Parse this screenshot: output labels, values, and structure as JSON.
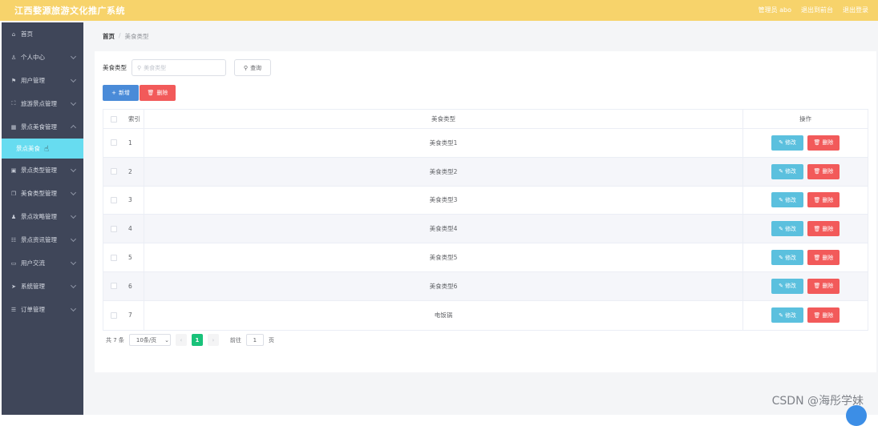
{
  "header": {
    "title": "江西婺源旅游文化推广系统",
    "links": [
      "管理员 abo",
      "退出到前台",
      "退出登录"
    ]
  },
  "sidebar": {
    "items": [
      {
        "label": "首页",
        "icon": "home-icon",
        "glyph": "⌂",
        "chevron": false
      },
      {
        "label": "个人中心",
        "icon": "user-icon",
        "glyph": "♙",
        "chevron": "down"
      },
      {
        "label": "用户管理",
        "icon": "flag-icon",
        "glyph": "⚑",
        "chevron": "down"
      },
      {
        "label": "旅游景点管理",
        "icon": "frame-icon",
        "glyph": "⛶",
        "chevron": "down"
      },
      {
        "label": "景点美食管理",
        "icon": "grid-icon",
        "glyph": "▦",
        "chevron": "up"
      }
    ],
    "active_sub": {
      "label": "景点美食"
    },
    "items_after": [
      {
        "label": "景点类型管理",
        "icon": "image-icon",
        "glyph": "▣",
        "chevron": "down"
      },
      {
        "label": "美食类型管理",
        "icon": "copy-icon",
        "glyph": "❐",
        "chevron": "down"
      },
      {
        "label": "景点攻略管理",
        "icon": "person-icon",
        "glyph": "♟",
        "chevron": "down"
      },
      {
        "label": "景点资讯管理",
        "icon": "sliders-icon",
        "glyph": "☷",
        "chevron": "down"
      },
      {
        "label": "用户交流",
        "icon": "chat-icon",
        "glyph": "▭",
        "chevron": "down"
      },
      {
        "label": "系统管理",
        "icon": "send-icon",
        "glyph": "➤",
        "chevron": "down"
      },
      {
        "label": "订单管理",
        "icon": "list-icon",
        "glyph": "☰",
        "chevron": "down"
      }
    ]
  },
  "breadcrumb": {
    "home": "首页",
    "sep": "/",
    "current": "美食类型"
  },
  "search": {
    "label": "美食类型",
    "placeholder": "美食类型",
    "button": "查询"
  },
  "actions": {
    "add": "新增",
    "delete": "删除"
  },
  "table": {
    "headers": {
      "index": "索引",
      "type": "美食类型",
      "ops": "操作"
    },
    "rows": [
      {
        "index": "1",
        "type": "美食类型1"
      },
      {
        "index": "2",
        "type": "美食类型2"
      },
      {
        "index": "3",
        "type": "美食类型3"
      },
      {
        "index": "4",
        "type": "美食类型4"
      },
      {
        "index": "5",
        "type": "美食类型5"
      },
      {
        "index": "6",
        "type": "美食类型6"
      },
      {
        "index": "7",
        "type": "电饭锅"
      }
    ],
    "edit_label": "修改",
    "delete_label": "删除"
  },
  "pagination": {
    "total": "共 7 条",
    "page_size": "10条/页",
    "current_page": "1",
    "goto_prefix": "前往",
    "goto_value": "1",
    "goto_suffix": "页"
  },
  "watermark": "CSDN @海彤学妹",
  "colors": {
    "topbar": "#f7d36b",
    "sidebar": "#3f4659",
    "active": "#67dcf0",
    "primary": "#4a8bd8",
    "danger": "#f25a5a",
    "info": "#5bc0de",
    "success": "#19c27a"
  }
}
